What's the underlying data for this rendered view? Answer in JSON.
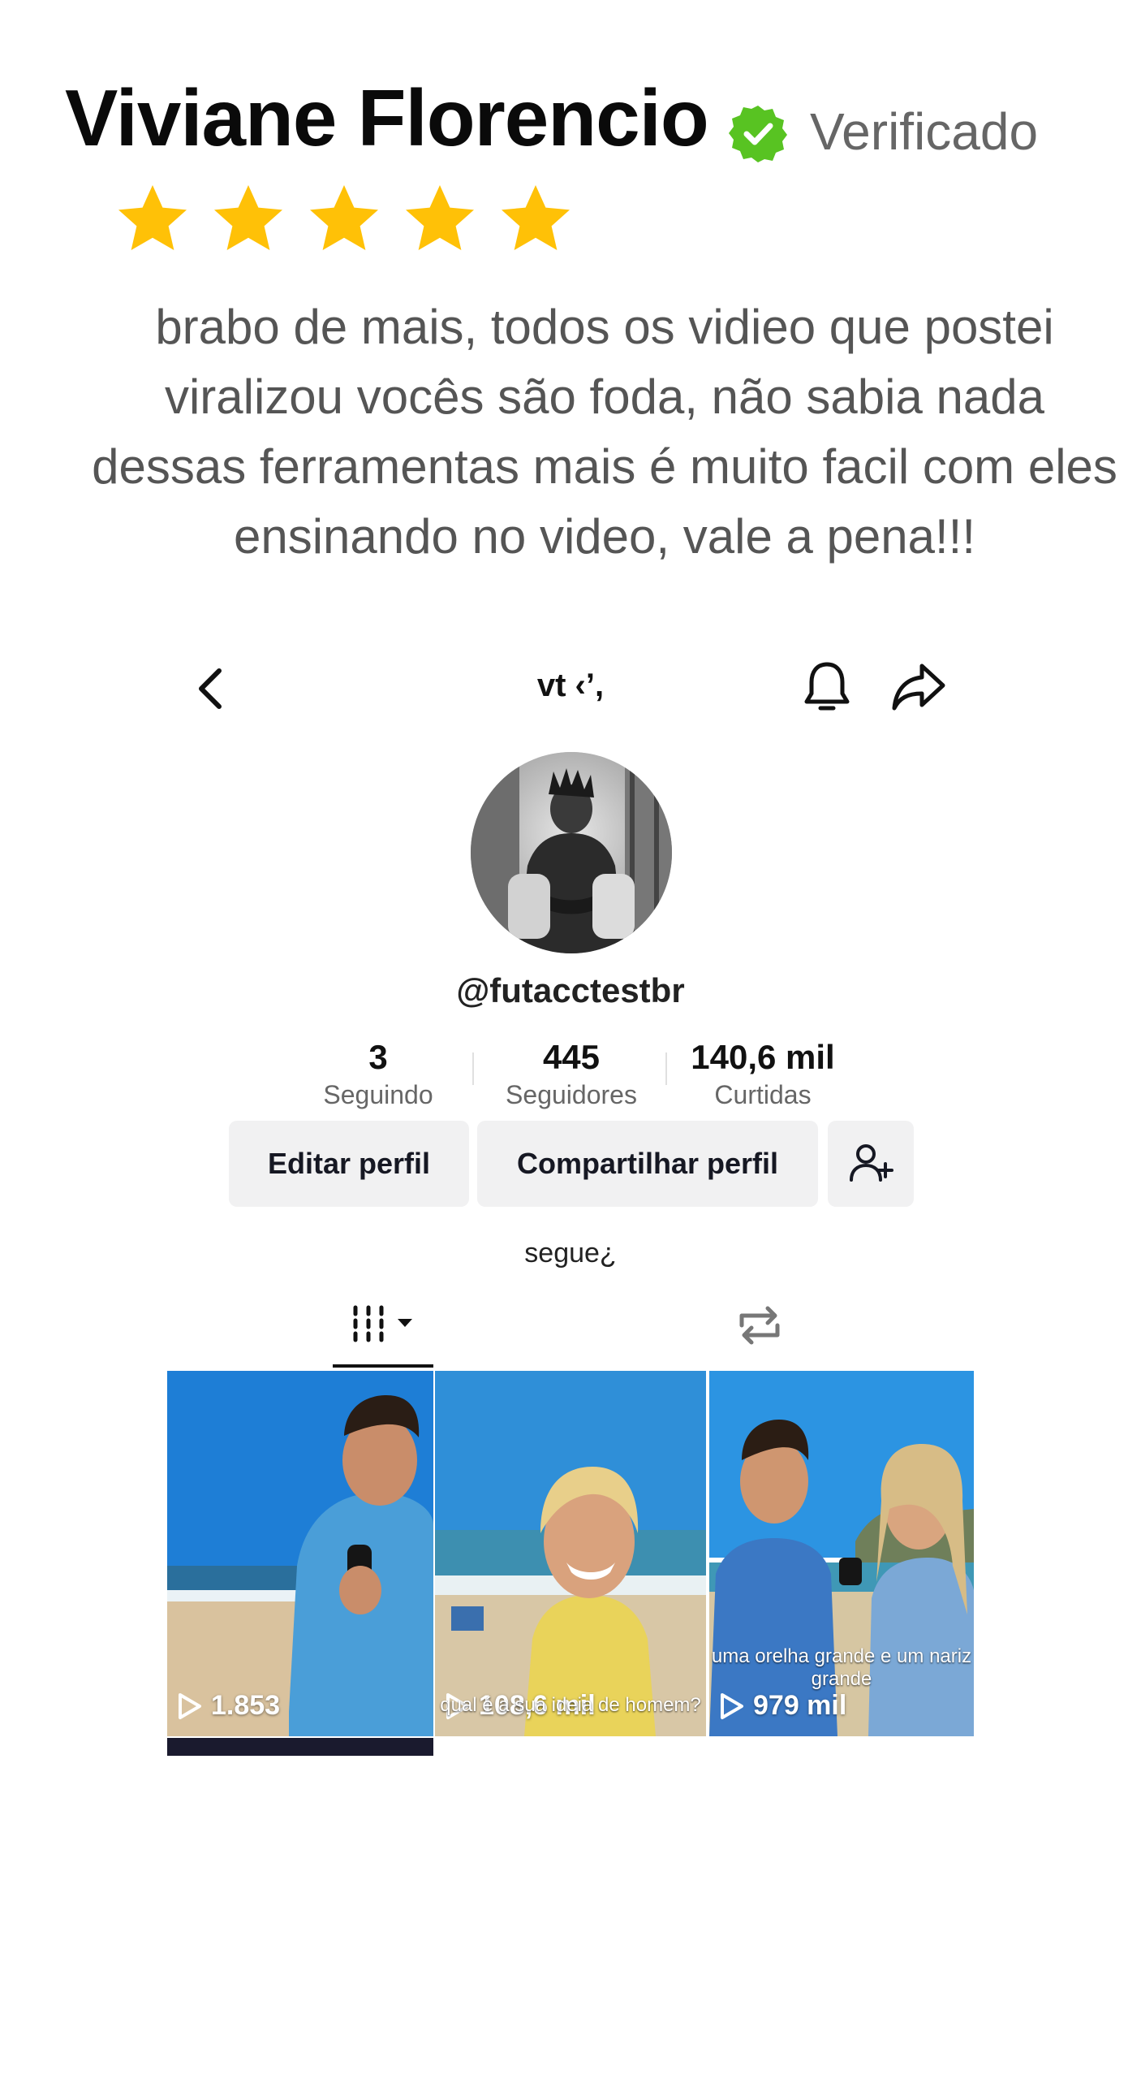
{
  "review": {
    "name": "Viviane Florencio",
    "verified_label": "Verificado",
    "rating": 5,
    "text": "brabo de mais, todos os vidieo que postei viralizou vocês são foda, não sabia nada dessas ferramentas mais é muito facil com eles ensinando no video, vale a pena!!!",
    "colors": {
      "star": "#FFC107",
      "verified": "#58C322",
      "name": "#0A0A0A",
      "text": "#555555"
    }
  },
  "profile": {
    "nav": {
      "title": "vt ‹’,",
      "icons": [
        "chevron-left-icon",
        "bell-icon",
        "share-icon"
      ]
    },
    "username": "@futacctestbr",
    "stats": [
      {
        "value": "3",
        "label": "Seguindo"
      },
      {
        "value": "445",
        "label": "Seguidores"
      },
      {
        "value": "140,6 mil",
        "label": "Curtidas"
      }
    ],
    "buttons": {
      "edit": "Editar perfil",
      "share": "Compartilhar perfil",
      "add_friend_icon": "add-user-icon"
    },
    "bio": "segue¿",
    "tabs": [
      "grid-icon",
      "repost-icon"
    ],
    "videos": [
      {
        "views": "1.853",
        "caption": ""
      },
      {
        "views": "108,6 mil",
        "caption": "qual é a sua ideia de homem?"
      },
      {
        "views": "979 mil",
        "caption": "uma orelha grande e um nariz grande"
      }
    ]
  }
}
